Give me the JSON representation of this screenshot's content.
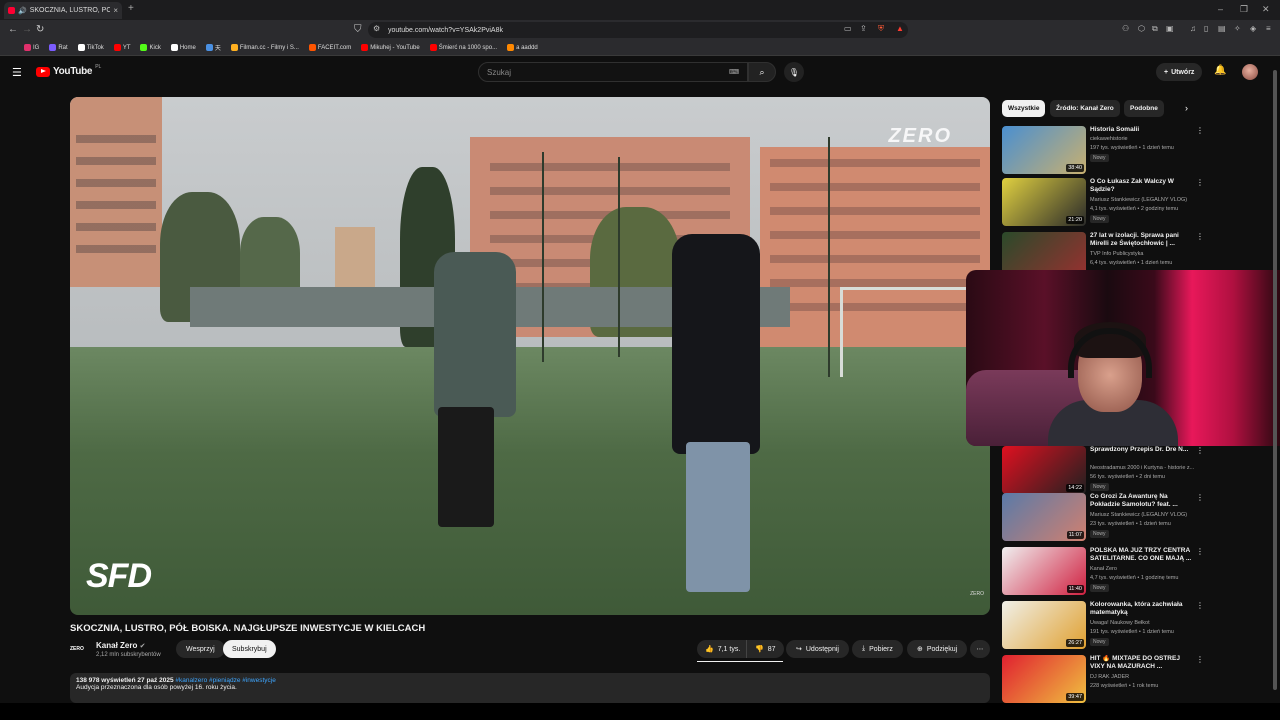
{
  "browser": {
    "tab_title": "SKOCZNIA, LUSTRO, PÓŁ BOISKA",
    "tab_close": "×",
    "new_tab": "+",
    "url": "youtube.com/watch?v=YSAk2PviA8k",
    "badge_count": "2"
  },
  "bookmarks": [
    {
      "label": "IG",
      "color": "#e1306c"
    },
    {
      "label": "Rat",
      "color": "#7b5cff"
    },
    {
      "label": "TikTok",
      "color": "#ffffff"
    },
    {
      "label": "YT",
      "color": "#ff0000"
    },
    {
      "label": "Kick",
      "color": "#53fc18"
    },
    {
      "label": "Home",
      "color": "#ffffff"
    },
    {
      "label": "天",
      "color": "#4a90e2"
    },
    {
      "label": "Filman.cc - Filmy i S...",
      "color": "#ffb020"
    },
    {
      "label": "FACEIT.com",
      "color": "#ff5500"
    },
    {
      "label": "Mikuhej - YouTube",
      "color": "#ff0000"
    },
    {
      "label": "Śmierć na 1000 spo...",
      "color": "#ff0000"
    },
    {
      "label": "a aaddd",
      "color": "#ff8800"
    }
  ],
  "yt": {
    "logo_text": "YouTube",
    "region": "PL",
    "search_placeholder": "Szukaj",
    "create_label": "Utwórz"
  },
  "video": {
    "title": "SKOCZNIA, LUSTRO, PÓŁ BOISKA. NAJGŁUPSZE INWESTYCJE W KIELCACH",
    "watermark_top": "ZERO",
    "watermark_bottom": "SFD",
    "watermark_small": "ZERO",
    "channel_logo": "ZERO",
    "channel_name": "Kanał Zero",
    "channel_subs": "2,12 mln subskrybentów",
    "support_label": "Wesprzyj",
    "subscribe_label": "Subskrybuj",
    "likes": "7,1 tys.",
    "dislikes": "87",
    "share_label": "Udostępnij",
    "download_label": "Pobierz",
    "thanks_label": "Podziękuj",
    "views_date": "138 978 wyświetleń  27 paź 2025",
    "hashtags": "#kanalzero #pieniądze #inwestycje",
    "desc_line": "Audycja przeznaczona dla osób powyżej 16. roku życia."
  },
  "chips": [
    "Wszystkie",
    "Źródło: Kanał Zero",
    "Podobne"
  ],
  "recommendations": [
    {
      "title": "Historia Somalii",
      "channel": "ciekawehistorie",
      "views": "197 tys. wyświetleń • 1 dzień temu",
      "badge": "Nowy",
      "duration": "38:40",
      "c1": "#4a8fd0",
      "c2": "#c8b070"
    },
    {
      "title": "O Co Łukasz Żak Walczy W Sądzie?",
      "channel": "Mariusz Stankiewicz (LEGALNY VLOG)",
      "views": "4,1 tys. wyświetleń • 2 godziny temu",
      "badge": "Nowy",
      "duration": "21:20",
      "c1": "#e0d040",
      "c2": "#2a2a2a"
    },
    {
      "title": "27 lat w izolacji. Sprawa pani Mirelli ze Świętochłowic | ...",
      "channel": "TVP Info Publicystyka",
      "views": "6,4 tys. wyświetleń • 1 dzień temu",
      "badge": "",
      "duration": "",
      "c1": "#2a4a2a",
      "c2": "#9a3030"
    },
    {
      "title": "Sprawdzony Przepis Dr. Dre N...",
      "channel": "Neostradamus 2000 i Kurtyna - historie z...",
      "views": "56 tys. wyświetleń • 2 dni temu",
      "badge": "Nowy",
      "duration": "14:22",
      "c1": "#e01020",
      "c2": "#202020"
    },
    {
      "title": "Co Grozi Za Awanturę Na Pokładzie Samolotu? feat. ...",
      "channel": "Mariusz Stankiewicz (LEGALNY VLOG)",
      "views": "23 tys. wyświetleń • 1 dzień temu",
      "badge": "Nowy",
      "duration": "11:07",
      "c1": "#5a7aa8",
      "c2": "#d08070"
    },
    {
      "title": "POLSKA MA JUŻ TRZY CENTRA SATELITARNE. CO ONE MAJĄ ...",
      "channel": "Kanał Zero",
      "views": "4,7 tys. wyświetleń • 1 godzinę temu",
      "badge": "Nowy",
      "duration": "11:40",
      "c1": "#f0f0f0",
      "c2": "#d02040"
    },
    {
      "title": "Kolorowanka, która zachwiała matematyką",
      "channel": "Uwaga! Naukowy Bełkot",
      "views": "191 tys. wyświetleń • 1 dzień temu",
      "badge": "Nowy",
      "duration": "26:27",
      "c1": "#f0f0e8",
      "c2": "#e0a030"
    },
    {
      "title": "HIT 🔥 MIXTAPE DO OSTREJ VIXY NA MAZURACH ...",
      "channel": "DJ RAK JADER",
      "views": "228 wyświetleń • 1 rok temu",
      "badge": "",
      "duration": "39:47",
      "c1": "#e02030",
      "c2": "#f0c040"
    }
  ]
}
